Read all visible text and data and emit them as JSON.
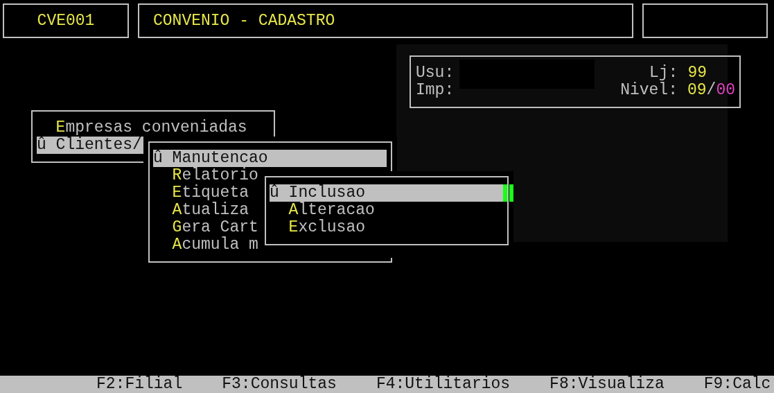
{
  "header": {
    "code": "CVE001",
    "title": "CONVENIO - CADASTRO"
  },
  "info": {
    "user_label": "Usu:",
    "printer_label": "Imp:",
    "store_label": "Lj:",
    "store": "99",
    "level_label": "Nivel:",
    "level_main": "09",
    "level_sep": "/",
    "level_sub": "00"
  },
  "menus": [
    {
      "items": [
        {
          "label": "Empresas conveniadas",
          "selected": false
        },
        {
          "label": "û Clientes/",
          "selected": true
        }
      ]
    },
    {
      "items": [
        {
          "label": "û Manutencao",
          "selected": true
        },
        {
          "label": "Relatorio",
          "selected": false
        },
        {
          "label": "Etiqueta",
          "selected": false
        },
        {
          "label": "Atualiza",
          "selected": false
        },
        {
          "label": "Gera Cart",
          "selected": false
        },
        {
          "label": "Acumula m",
          "selected": false
        }
      ]
    },
    {
      "items": [
        {
          "label": "û Inclusao",
          "selected": true
        },
        {
          "label": "Alteracao",
          "selected": false
        },
        {
          "label": "Exclusao",
          "selected": false
        }
      ]
    }
  ],
  "function_keys": [
    "F2:Filial",
    "F3:Consultas",
    "F4:Utilitarios",
    "F8:Visualiza",
    "F9:Calc"
  ]
}
